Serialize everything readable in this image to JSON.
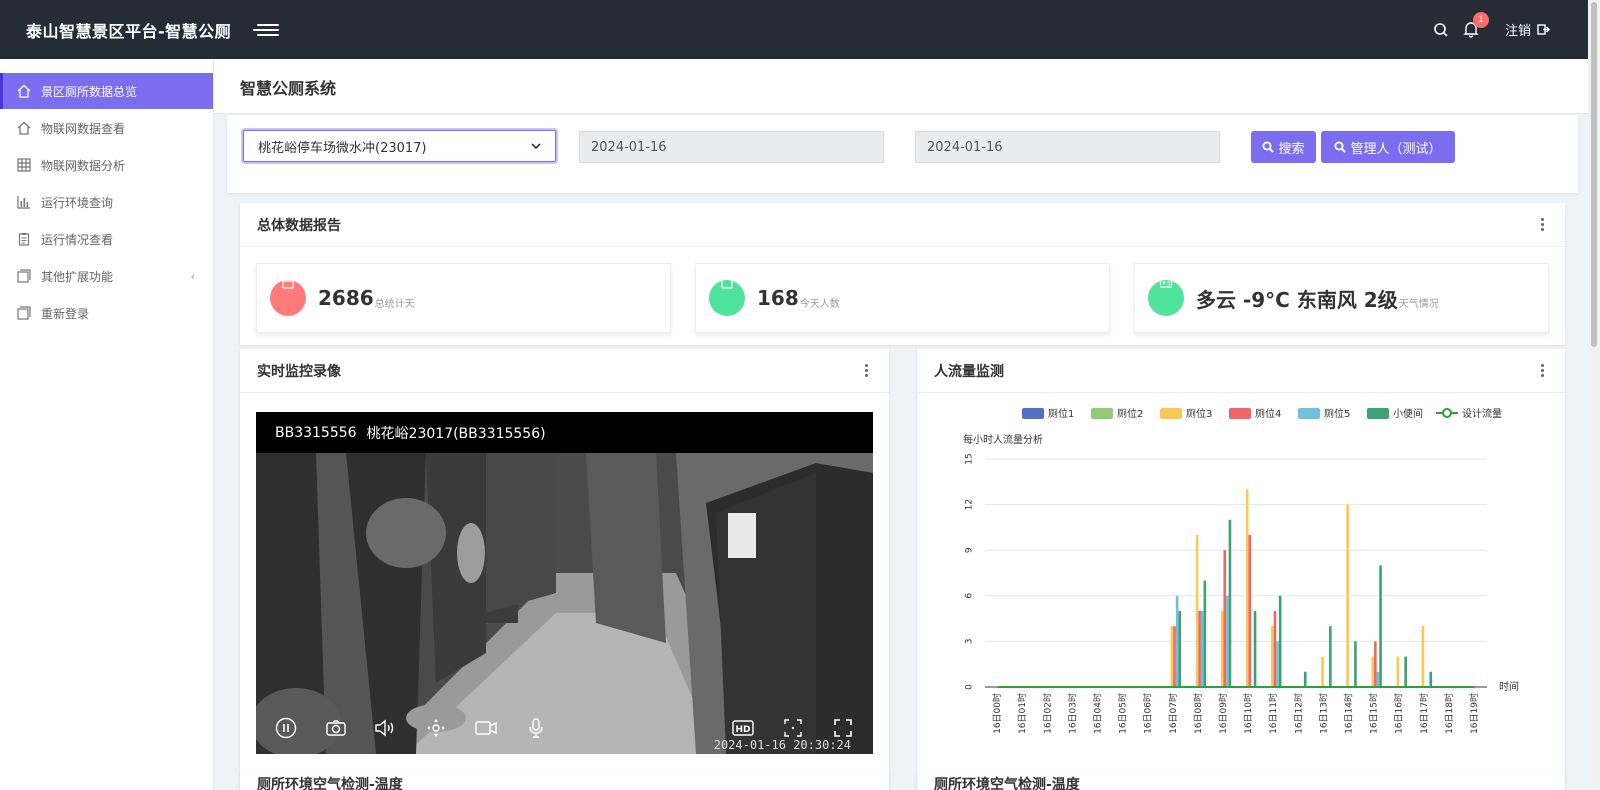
{
  "header": {
    "title": "泰山智慧景区平台-智慧公厕",
    "notification_count": "1",
    "logout_label": "注销"
  },
  "sidebar": {
    "items": [
      {
        "label": "景区厕所数据总览",
        "icon": "home-icon"
      },
      {
        "label": "物联网数据查看",
        "icon": "home-icon"
      },
      {
        "label": "物联网数据分析",
        "icon": "grid-icon"
      },
      {
        "label": "运行环境查询",
        "icon": "bar-chart-icon"
      },
      {
        "label": "运行情况查看",
        "icon": "clipboard-icon"
      },
      {
        "label": "其他扩展功能",
        "icon": "window-icon"
      },
      {
        "label": "重新登录",
        "icon": "window-icon"
      }
    ]
  },
  "page": {
    "title": "智慧公厕系统"
  },
  "filter": {
    "selected_site": "桃花峪停车场微水冲(23017)",
    "start_date": "2024-01-16",
    "end_date": "2024-01-16",
    "search_label": "搜索",
    "admin_label": "管理人（测试）"
  },
  "report": {
    "title": "总体数据报告",
    "stats": [
      {
        "value": "2686",
        "label": "总统计天",
        "color": "#ff7b7b"
      },
      {
        "value": "168",
        "label": "今天人数",
        "color": "#4fe39b"
      },
      {
        "value": "多云 -9°C 东南风 2级",
        "label": "天气情况",
        "color": "#4fe39b"
      }
    ]
  },
  "video_panel": {
    "title": "实时监控录像",
    "device_id": "BB3315556",
    "device_name": "桃花峪23017(BB3315556)",
    "timestamp": "2024-01-16 20:30:24"
  },
  "flow_panel": {
    "title": "人流量监测"
  },
  "chart_data": {
    "type": "bar",
    "title": "",
    "ylabel": "每小时人流量分析",
    "xlabel": "时间",
    "ylim": [
      0,
      15
    ],
    "yticks": [
      0,
      3,
      6,
      9,
      12,
      15
    ],
    "categories": [
      "16日00时",
      "16日01时",
      "16日02时",
      "16日03时",
      "16日04时",
      "16日05时",
      "16日06时",
      "16日07时",
      "16日08时",
      "16日09时",
      "16日10时",
      "16日11时",
      "16日12时",
      "16日13时",
      "16日14时",
      "16日15时",
      "16日16时",
      "16日17时",
      "16日18时",
      "16日19时"
    ],
    "series": [
      {
        "name": "厕位1",
        "color": "#5470c6",
        "values": [
          0,
          0,
          0,
          0,
          0,
          0,
          0,
          0,
          0,
          0,
          0,
          0,
          0,
          0,
          0,
          0,
          0,
          0,
          0,
          0
        ]
      },
      {
        "name": "厕位2",
        "color": "#91cc75",
        "values": [
          0,
          0,
          0,
          0,
          0,
          0,
          0,
          0,
          0,
          0,
          0,
          0,
          0,
          0,
          0,
          0,
          0,
          0,
          0,
          0
        ]
      },
      {
        "name": "厕位3",
        "color": "#fac858",
        "values": [
          0,
          0,
          0,
          0,
          0,
          0,
          0,
          4,
          10,
          5,
          13,
          4,
          0,
          2,
          12,
          2,
          2,
          4,
          0,
          0
        ]
      },
      {
        "name": "厕位4",
        "color": "#ee6666",
        "values": [
          0,
          0,
          0,
          0,
          0,
          0,
          0,
          4,
          5,
          9,
          10,
          5,
          0,
          0,
          0,
          3,
          0,
          0,
          0,
          0
        ]
      },
      {
        "name": "厕位5",
        "color": "#73c0de",
        "values": [
          0,
          0,
          0,
          0,
          0,
          0,
          0,
          6,
          5,
          6,
          0,
          3,
          0,
          0,
          0,
          1,
          0,
          0,
          0,
          0
        ]
      },
      {
        "name": "小便间",
        "color": "#3ba272",
        "values": [
          0,
          0,
          0,
          0,
          0,
          0,
          0,
          5,
          7,
          11,
          5,
          6,
          1,
          4,
          3,
          8,
          2,
          1,
          0,
          0
        ]
      },
      {
        "name": "设计流量",
        "color": "#2e9e3e",
        "type": "line",
        "values": [
          0,
          0,
          0,
          0,
          0,
          0,
          0,
          0,
          0,
          0,
          0,
          0,
          0,
          0,
          0,
          0,
          0,
          0,
          0,
          0
        ]
      }
    ],
    "legend_position": "top-center",
    "grid": true
  },
  "bottom_panels": {
    "left_title": "厕所环境空气检测-温度",
    "right_title": "厕所环境空气检测-温度"
  }
}
